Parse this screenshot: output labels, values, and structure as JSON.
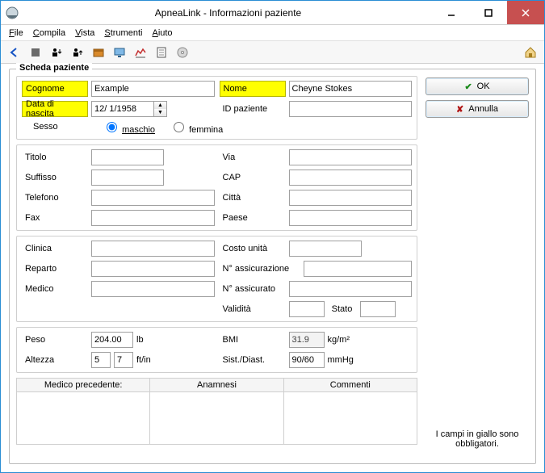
{
  "window": {
    "title": "ApneaLink - Informazioni paziente"
  },
  "menu": {
    "file": "File",
    "compila": "Compila",
    "vista": "Vista",
    "strumenti": "Strumenti",
    "aiuto": "Aiuto"
  },
  "legend": "Scheda paziente",
  "buttons": {
    "ok": "OK",
    "cancel": "Annulla"
  },
  "note": "I campi in giallo sono obbligatori.",
  "labels": {
    "cognome": "Cognome",
    "nome": "Nome",
    "data_nascita": "Data di nascita",
    "id_paziente": "ID paziente",
    "sesso": "Sesso",
    "maschio": "maschio",
    "femmina": "femmina",
    "titolo": "Titolo",
    "via": "Via",
    "suffisso": "Suffisso",
    "cap": "CAP",
    "telefono": "Telefono",
    "citta": "Città",
    "fax": "Fax",
    "paese": "Paese",
    "clinica": "Clinica",
    "costo_unita": "Costo unità",
    "reparto": "Reparto",
    "n_assicurazione": "N° assicurazione",
    "medico": "Medico",
    "n_assicurato": "N° assicurato",
    "validita": "Validità",
    "stato": "Stato",
    "peso": "Peso",
    "bmi": "BMI",
    "altezza": "Altezza",
    "sist_diast": "Sist./Diast.",
    "medico_prec": "Medico precedente:",
    "anamnesi": "Anamnesi",
    "commenti": "Commenti"
  },
  "units": {
    "peso": "lb",
    "altezza": "ft/in",
    "bmi": "kg/m²",
    "sist_diast": "mmHg"
  },
  "values": {
    "cognome": "Example",
    "nome": "Cheyne Stokes",
    "data_nascita": "12/ 1/1958",
    "id_paziente": "",
    "sesso": "maschio",
    "titolo": "",
    "via": "",
    "suffisso": "",
    "cap": "",
    "telefono": "",
    "citta": "",
    "fax": "",
    "paese": "",
    "clinica": "",
    "costo_unita": "",
    "reparto": "",
    "n_assicurazione": "",
    "medico": "",
    "n_assicurato": "",
    "validita": "",
    "stato": "",
    "peso": "204.00",
    "altezza_ft": "5",
    "altezza_in": "7",
    "bmi": "31.9",
    "sist_diast": "90/60",
    "medico_prec": "",
    "anamnesi": "",
    "commenti": ""
  }
}
